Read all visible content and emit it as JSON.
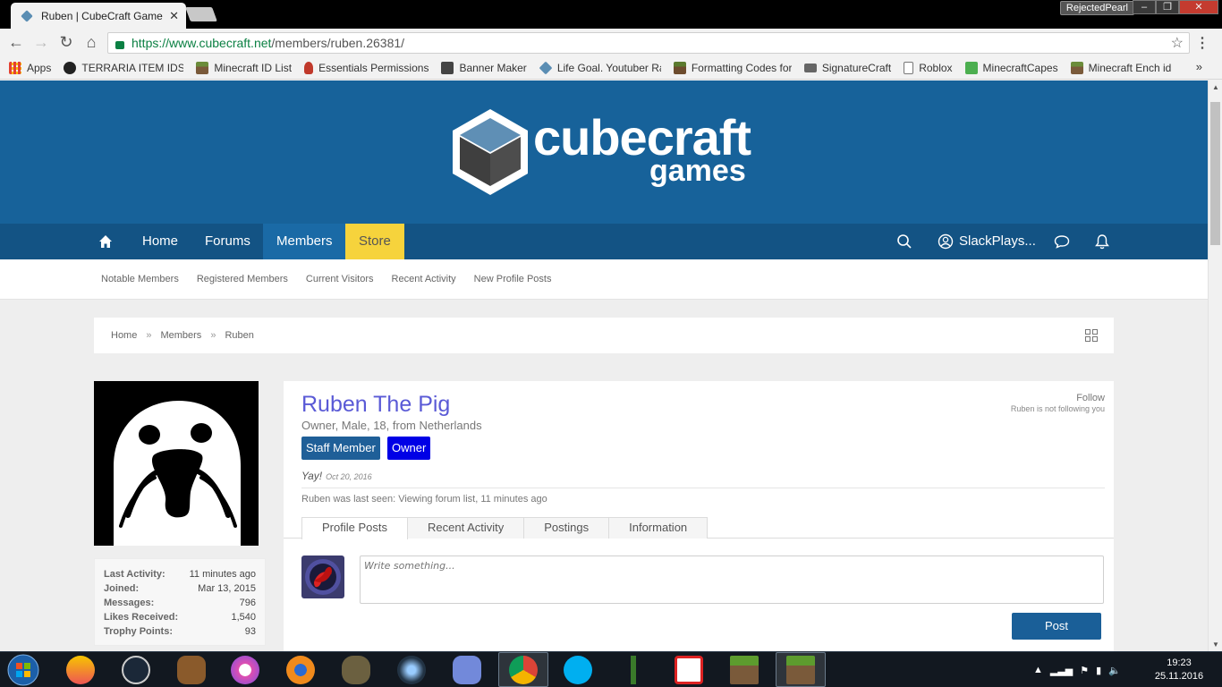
{
  "browser": {
    "tab_title": "Ruben | CubeCraft Game",
    "tab_close": "✕",
    "windows_user": "RejectedPearl",
    "win_min": "–",
    "win_max": "❐",
    "win_close": "✕",
    "nav_back": "←",
    "nav_forward": "→",
    "nav_reload": "↻",
    "nav_home": "⌂",
    "url_host": "https://www.cubecraft.net",
    "url_path": "/members/ruben.26381/",
    "star": "☆",
    "menu": "⋮",
    "bookmarks_more": "»"
  },
  "bookmarks": [
    {
      "label": "Apps",
      "color": "#e34133"
    },
    {
      "label": "TERRARIA ITEM IDS C",
      "color": "#222222"
    },
    {
      "label": "Minecraft ID List",
      "color": "#6b8c3a"
    },
    {
      "label": "Essentials Permissions",
      "color": "#c0392b"
    },
    {
      "label": "Banner Maker",
      "color": "#444444"
    },
    {
      "label": "Life Goal. Youtuber Ra",
      "color": "#5a8db3"
    },
    {
      "label": "Formatting Codes for",
      "color": "#5b7a2e"
    },
    {
      "label": "SignatureCraft",
      "color": "#666666"
    },
    {
      "label": "Roblox",
      "color": "#ffffff"
    },
    {
      "label": "MinecraftCapes",
      "color": "#4caf50"
    },
    {
      "label": "Minecraft Ench id",
      "color": "#6b8c3a"
    }
  ],
  "site": {
    "logo_word1": "cubecraft",
    "logo_word2": "games",
    "nav": {
      "home": "Home",
      "forums": "Forums",
      "members": "Members",
      "store": "Store",
      "user": "SlackPlays..."
    },
    "subnav": [
      "Notable Members",
      "Registered Members",
      "Current Visitors",
      "Recent Activity",
      "New Profile Posts"
    ],
    "breadcrumb": [
      "Home",
      "Members",
      "Ruben"
    ],
    "breadcrumb_sep": "»"
  },
  "profile": {
    "name": "Ruben The Pig",
    "description": "Owner, Male, 18, from Netherlands",
    "follow": "Follow",
    "follow_status": "Ruben is not following you",
    "badges": {
      "staff": "Staff Member",
      "owner": "Owner"
    },
    "status_text": "Yay!",
    "status_date": "Oct 20, 2016",
    "last_seen": "Ruben was last seen: Viewing forum list, 11 minutes ago",
    "tabs": [
      "Profile Posts",
      "Recent Activity",
      "Postings",
      "Information"
    ],
    "post_placeholder": "Write something...",
    "post_button": "Post",
    "stats": [
      {
        "label": "Last Activity:",
        "value": "11 minutes ago"
      },
      {
        "label": "Joined:",
        "value": "Mar 13, 2015"
      },
      {
        "label": "Messages:",
        "value": "796"
      },
      {
        "label": "Likes Received:",
        "value": "1,540"
      },
      {
        "label": "Trophy Points:",
        "value": "93"
      }
    ]
  },
  "taskbar": {
    "time": "19:23",
    "date": "25.11.2016"
  },
  "colors": {
    "header_blue": "#17629a",
    "nav_blue": "#135384",
    "store_yellow": "#f6d33c",
    "owner_badge": "#0000e6",
    "staff_badge": "#1f5f98",
    "name_purple": "#5a5ad6"
  }
}
